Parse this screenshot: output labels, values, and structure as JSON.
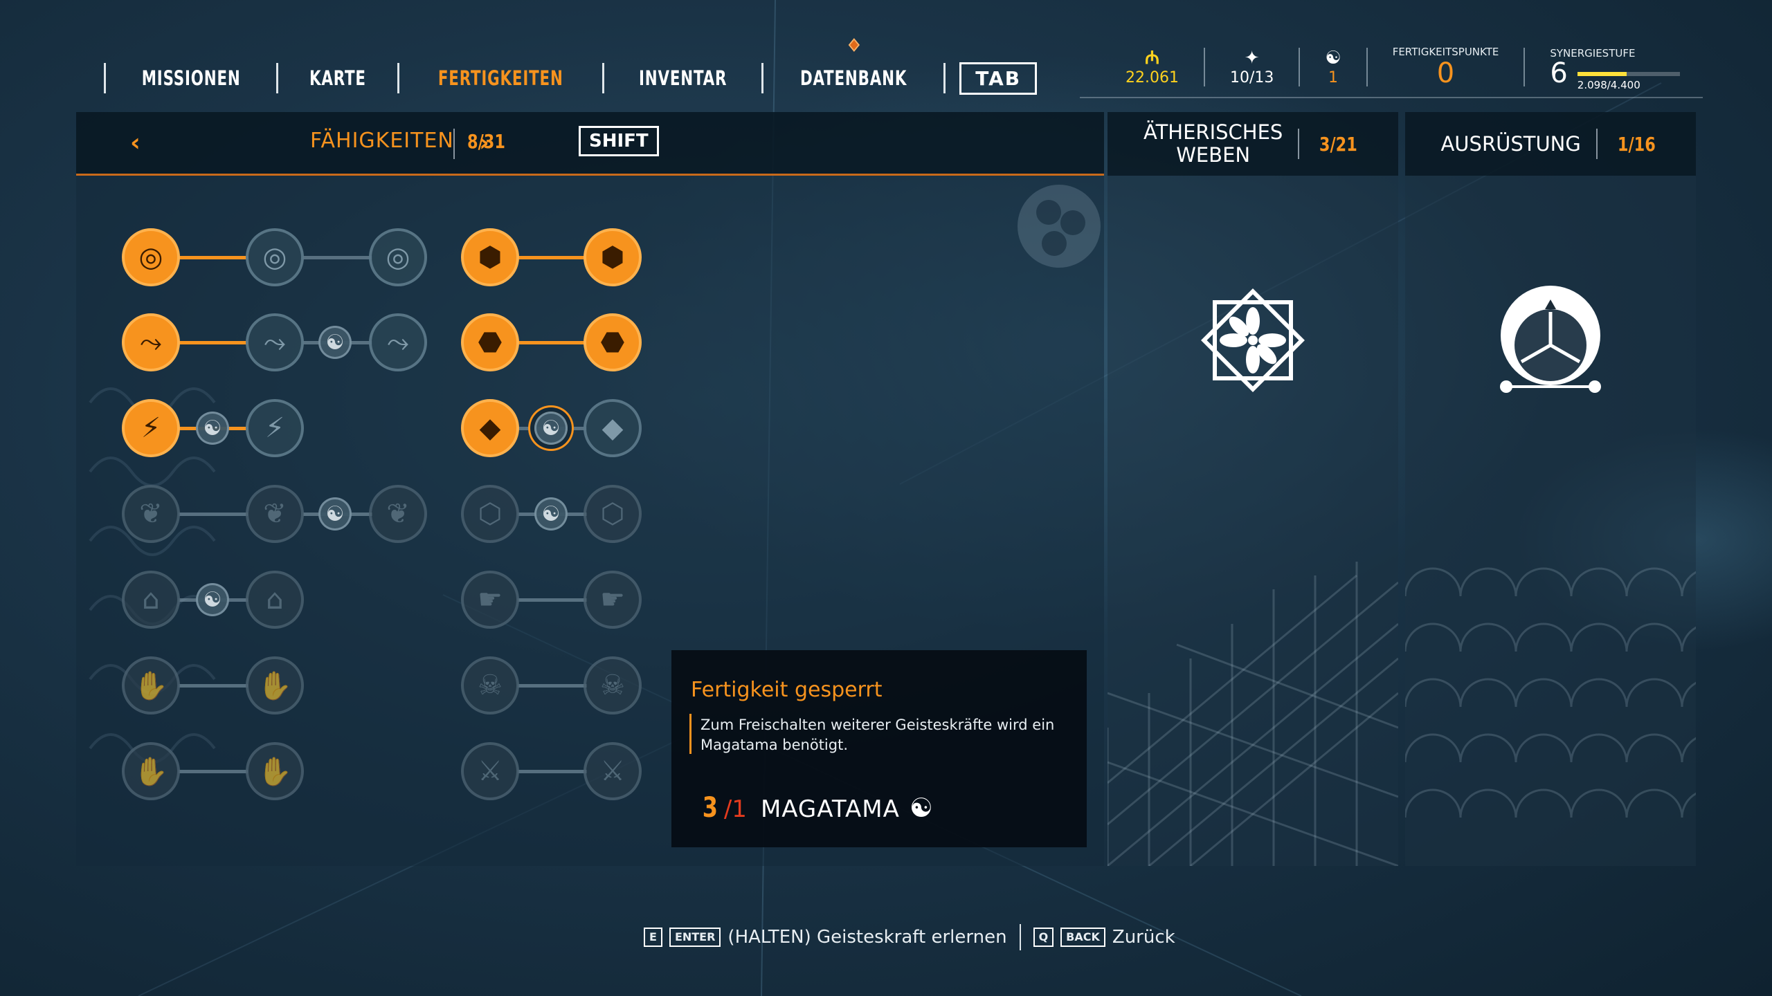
{
  "nav": {
    "items": [
      "MISSIONEN",
      "KARTE",
      "FERTIGKEITEN",
      "INVENTAR",
      "DATENBANK"
    ],
    "active_index": 2,
    "tab_key": "TAB"
  },
  "stats": {
    "currency": {
      "icon": "mon-currency-icon",
      "value": "22.061"
    },
    "knowledge": {
      "icon": "arrow-up-icon",
      "value": "10/13"
    },
    "magatama": {
      "icon": "magatama-icon",
      "value": "1"
    },
    "skill_points": {
      "label": "FERTIGKEITSPUNKTE",
      "value": "0"
    },
    "synergy": {
      "label": "SYNERGIESTUFE",
      "level": "6",
      "xp": "2.098/4.400",
      "progress": 0.477
    }
  },
  "header": {
    "title": "FÄHIGKEITEN",
    "count": "8/31",
    "shift_key": "SHIFT"
  },
  "side_panels": [
    {
      "title_line1": "ÄTHERISCHES",
      "title_line2": "WEBEN",
      "count": "3/21"
    },
    {
      "title_line1": "AUSRÜSTUNG",
      "title_line2": "",
      "count": "1/16"
    }
  ],
  "tooltip": {
    "title": "Fertigkeit gesperrt",
    "description": "Zum Freischalten weiterer Geisteskräfte wird ein Magatama benötigt.",
    "cost_have": "3",
    "cost_need": "/1",
    "cost_label": "MAGATAMA"
  },
  "footer": {
    "key1a": "E",
    "key1b": "ENTER",
    "action1": "(HALTEN) Geisteskraft erlernen",
    "key2a": "Q",
    "key2b": "BACK",
    "action2": "Zurück"
  },
  "colors": {
    "accent": "#f7931e",
    "currency": "#ffd21e",
    "alert": "#e43b1e"
  }
}
